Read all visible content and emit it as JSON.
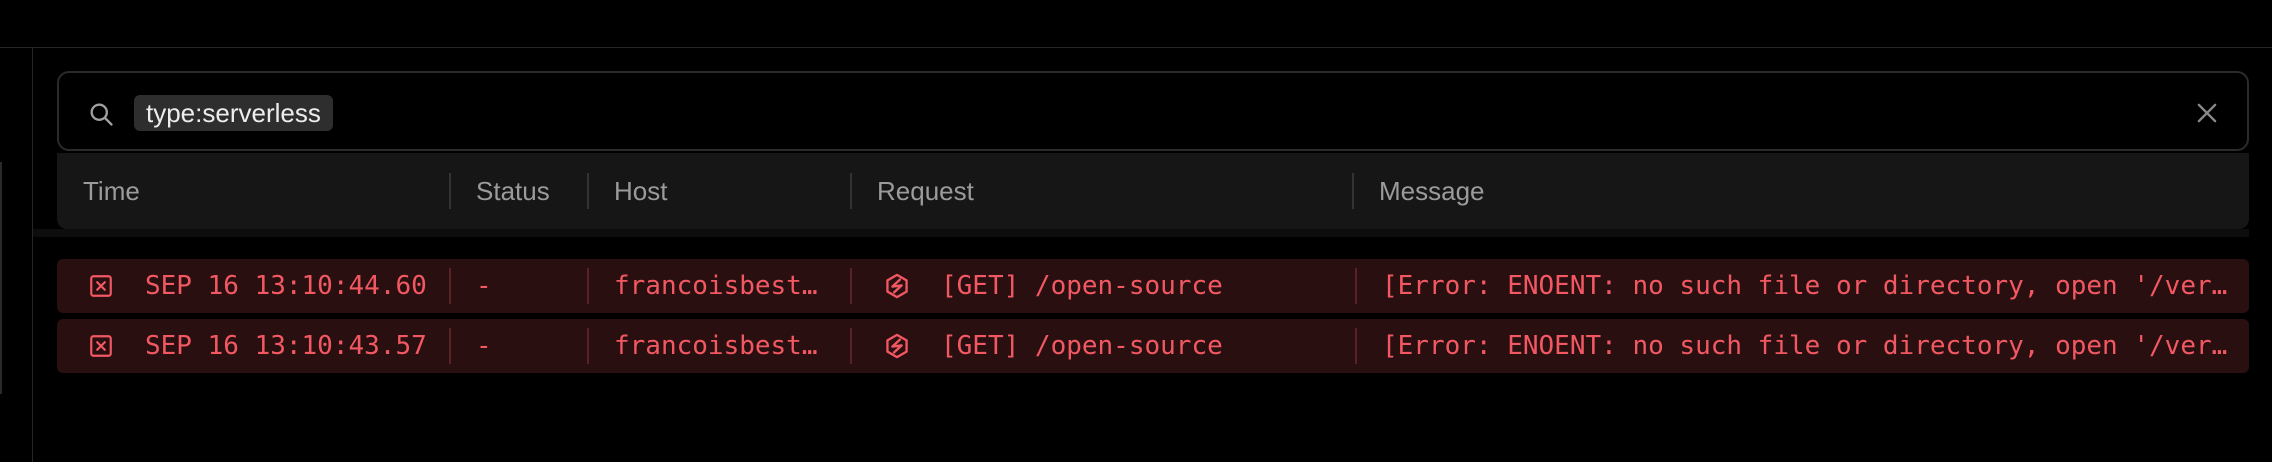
{
  "search": {
    "token": "type:serverless",
    "icon": "search-icon",
    "clear_icon": "close-icon"
  },
  "table": {
    "columns": [
      "Time",
      "Status",
      "Host",
      "Request",
      "Message"
    ],
    "rows": [
      {
        "time": "SEP 16 13:10:44.60",
        "status": "-",
        "host": "francoisbest…",
        "request": "[GET] /open-source",
        "message": "[Error: ENOENT: no such file or directory, open '/ver…",
        "level_icon": "error-x-icon",
        "type_icon": "serverless-function-icon"
      },
      {
        "time": "SEP 16 13:10:43.57",
        "status": "-",
        "host": "francoisbest…",
        "request": "[GET] /open-source",
        "message": "[Error: ENOENT: no such file or directory, open '/ver…",
        "level_icon": "error-x-icon",
        "type_icon": "serverless-function-icon"
      }
    ]
  },
  "colors": {
    "background": "#000000",
    "error_row_bg": "#2a0f11",
    "error_text": "#f25862",
    "header_bg": "#161616",
    "header_text": "#9b9b9b"
  }
}
